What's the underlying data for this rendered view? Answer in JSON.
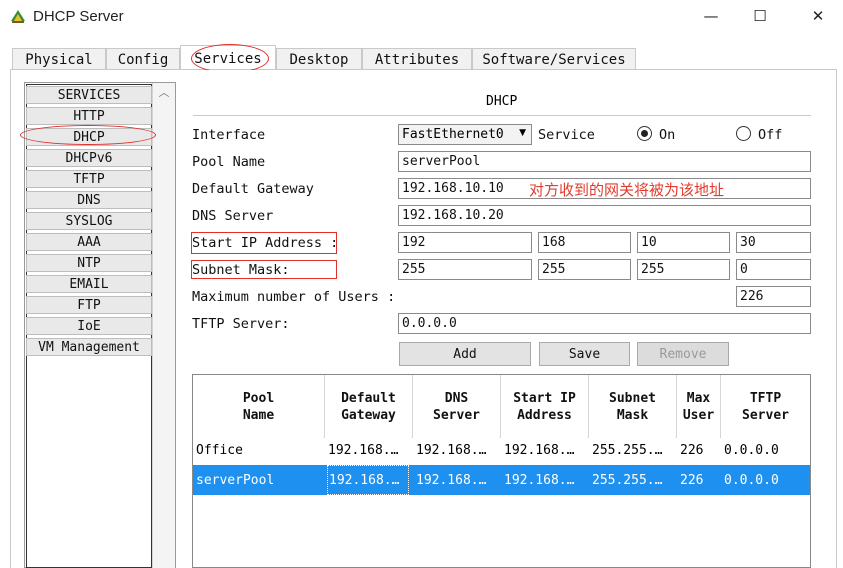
{
  "window": {
    "title": "DHCP Server",
    "minimize": "—",
    "maximize": "☐",
    "close": "✕"
  },
  "tabs": [
    "Physical",
    "Config",
    "Services",
    "Desktop",
    "Attributes",
    "Software/Services"
  ],
  "active_tab": "Services",
  "services": [
    "SERVICES",
    "HTTP",
    "DHCP",
    "DHCPv6",
    "TFTP",
    "DNS",
    "SYSLOG",
    "AAA",
    "NTP",
    "EMAIL",
    "FTP",
    "IoE",
    "VM Management"
  ],
  "selected_service": "DHCP",
  "panel": {
    "title": "DHCP",
    "interface_label": "Interface",
    "interface_value": "FastEthernet0",
    "service_label": "Service",
    "on_label": "On",
    "off_label": "Off",
    "service_on": true,
    "pool_name_label": "Pool Name",
    "pool_name": "serverPool",
    "gateway_label": "Default Gateway",
    "gateway": "192.168.10.10",
    "gateway_annotation": "对方收到的网关将被为该地址",
    "dns_label": "DNS Server",
    "dns": "192.168.10.20",
    "start_ip_label": "Start IP Address :",
    "start_ip": [
      "192",
      "168",
      "10",
      "30"
    ],
    "mask_label": "Subnet Mask:",
    "mask": [
      "255",
      "255",
      "255",
      "0"
    ],
    "max_users_label": "Maximum number of Users :",
    "max_users": "226",
    "tftp_label": "TFTP Server:",
    "tftp": "0.0.0.0",
    "buttons": {
      "add": "Add",
      "save": "Save",
      "remove": "Remove"
    }
  },
  "table": {
    "headers": [
      "Pool Name",
      "Default Gateway",
      "DNS Server",
      "Start IP Address",
      "Subnet Mask",
      "Max User",
      "TFTP Server"
    ],
    "rows": [
      [
        "Office",
        "192.168.…",
        "192.168.…",
        "192.168.…",
        "255.255.…",
        "226",
        "0.0.0.0"
      ],
      [
        "serverPool",
        "192.168.…",
        "192.168.…",
        "192.168.…",
        "255.255.…",
        "226",
        "0.0.0.0"
      ]
    ],
    "selected_row": 1
  },
  "colors": {
    "selection": "#1e90f0",
    "annotation": "#e23b2e"
  }
}
